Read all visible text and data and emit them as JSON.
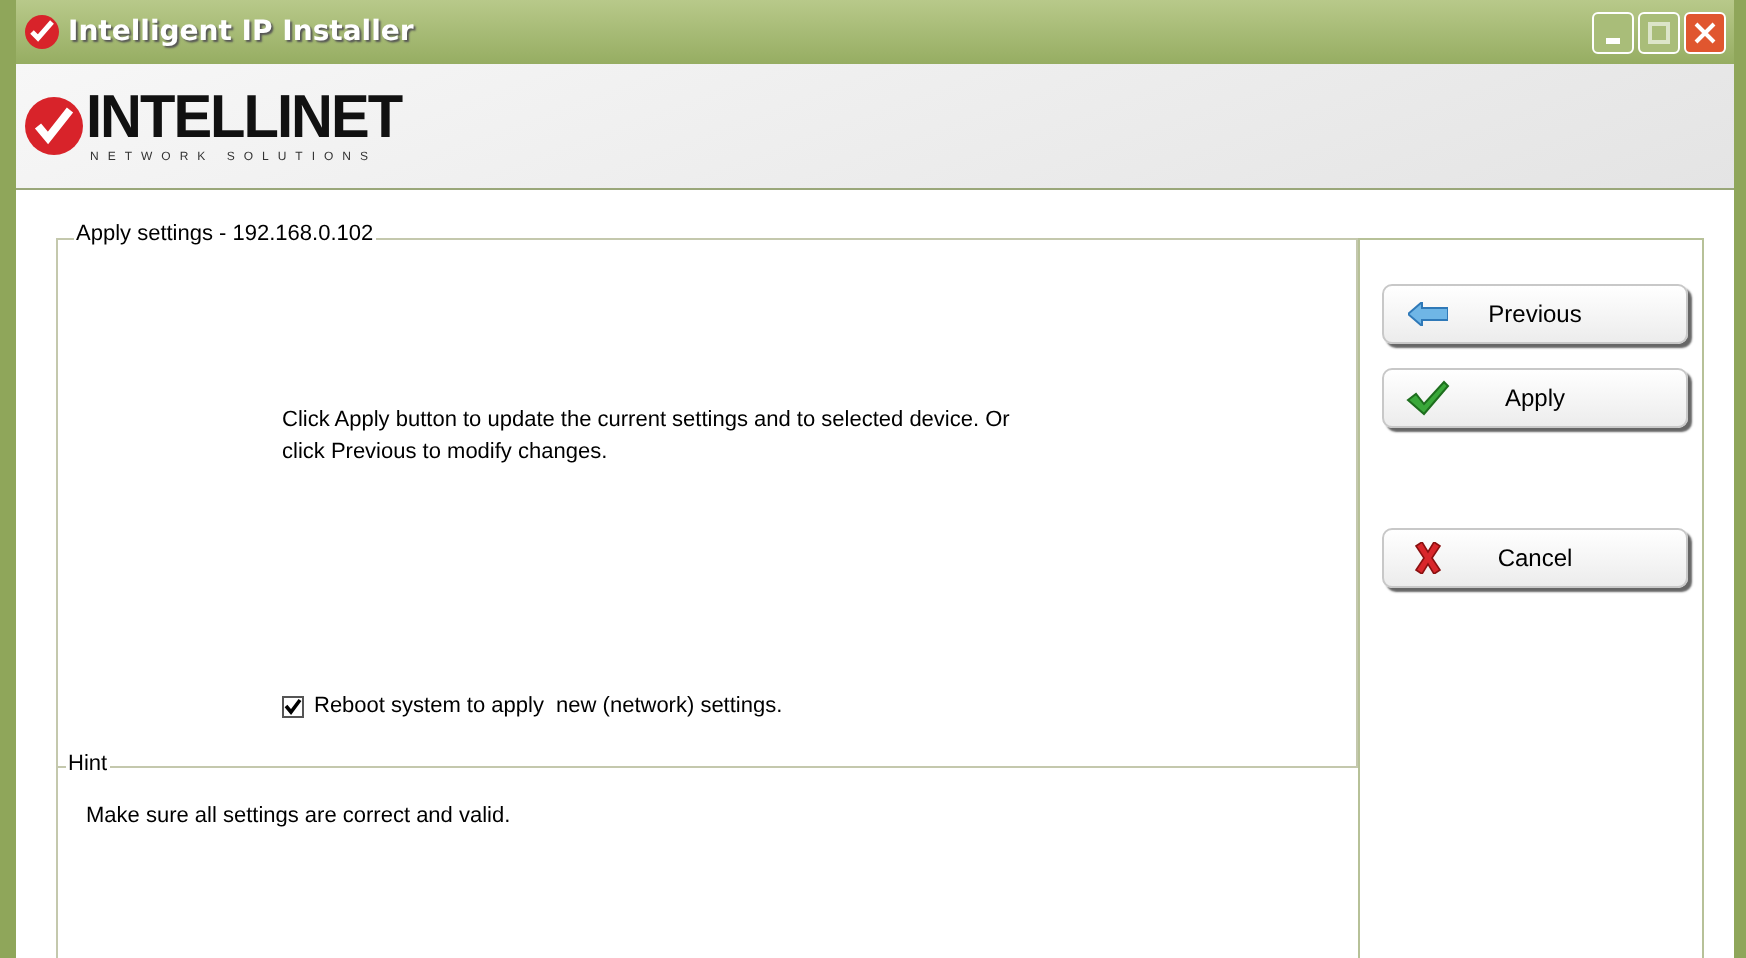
{
  "window": {
    "title": "Intelligent IP Installer"
  },
  "logo": {
    "name": "INTELLINET",
    "tagline": "NETWORK SOLUTIONS"
  },
  "settings": {
    "legend": "Apply settings - 192.168.0.102",
    "message": "Click Apply button to update the current settings and to selected device. Or click Previous to modify changes.",
    "reboot": {
      "label": "Reboot system to apply  new (network) settings.",
      "checked": true
    }
  },
  "hint": {
    "legend": "Hint",
    "text": "Make sure all settings are correct and valid."
  },
  "buttons": [
    {
      "label": "Previous",
      "kind": "previous"
    },
    {
      "label": "Apply",
      "kind": "apply"
    },
    {
      "label": "Cancel",
      "kind": "cancel"
    }
  ]
}
